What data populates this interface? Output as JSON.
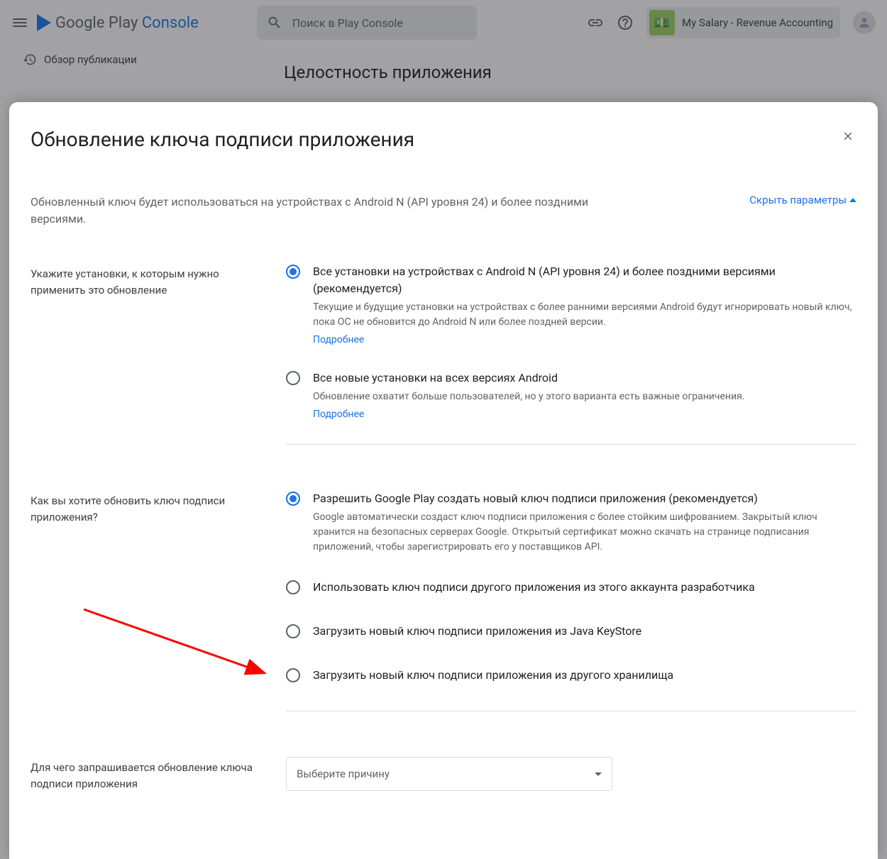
{
  "header": {
    "logo_primary": "Google Play",
    "logo_secondary": "Console",
    "search_placeholder": "Поиск в Play Console",
    "app_name": "My Salary - Revenue Accounting",
    "breadcrumb": "Обзор публикации",
    "page_title": "Целостность приложения"
  },
  "modal": {
    "title": "Обновление ключа подписи приложения",
    "intro": "Обновленный ключ будет использоваться на устройствах с Android N (API уровня 24) и более поздними версиями.",
    "toggle": "Скрыть параметры",
    "section1": {
      "label": "Укажите установки, к которым нужно применить это обновление",
      "option1": {
        "label": "Все установки на устройствах с Android N (API уровня 24) и более поздними версиями (рекомендуется)",
        "desc": "Текущие и будущие установки на устройствах с более ранними версиями Android будут игнорировать новый ключ, пока ОС не обновится до Android N или более поздней версии.",
        "link": "Подробнее"
      },
      "option2": {
        "label": "Все новые установки на всех версиях Android",
        "desc": "Обновление охватит больше пользователей, но у этого варианта есть важные ограничения.",
        "link": "Подробнее"
      }
    },
    "section2": {
      "label": "Как вы хотите обновить ключ подписи приложения?",
      "option1": {
        "label": "Разрешить Google Play создать новый ключ подписи приложения (рекомендуется)",
        "desc": "Google автоматически создаст ключ подписи приложения с более стойким шифрованием. Закрытый ключ хранится на безопасных серверах Google. Открытый сертификат можно скачать на странице подписания приложений, чтобы зарегистрировать его у поставщиков API."
      },
      "option2": {
        "label": "Использовать ключ подписи другого приложения из этого аккаунта разработчика"
      },
      "option3": {
        "label": "Загрузить новый ключ подписи приложения из Java KeyStore"
      },
      "option4": {
        "label": "Загрузить новый ключ подписи приложения из другого хранилища"
      }
    },
    "section3": {
      "label": "Для чего запрашивается обновление ключа подписи приложения",
      "select_placeholder": "Выберите причину"
    }
  }
}
